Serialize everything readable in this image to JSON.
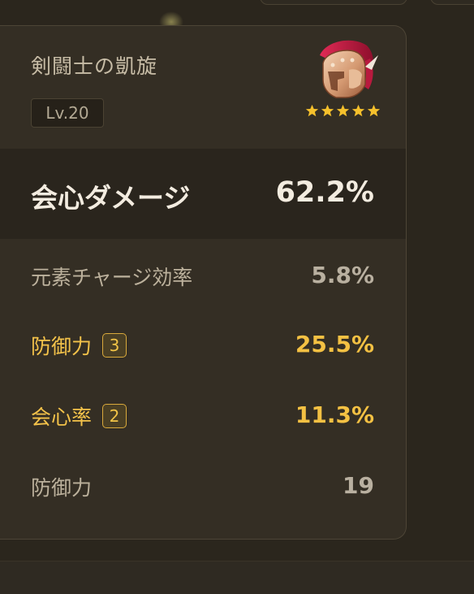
{
  "artifact": {
    "set_name": "剣闘士の凱旋",
    "level": "Lv.20",
    "rarity_stars": 5,
    "icon": "gladiator-helmet-icon"
  },
  "main_stat": {
    "label": "会心ダメージ",
    "value": "62.2%"
  },
  "sub_stats": [
    {
      "label": "元素チャージ効率",
      "value": "5.8%",
      "rolls": "",
      "highlight": false
    },
    {
      "label": "防御力",
      "value": "25.5%",
      "rolls": "3",
      "highlight": true
    },
    {
      "label": "会心率",
      "value": "11.3%",
      "rolls": "2",
      "highlight": true
    },
    {
      "label": "防御力",
      "value": "19",
      "rolls": "",
      "highlight": false
    }
  ],
  "colors": {
    "background": "#2b261d",
    "card": "#342e24",
    "highlight_gold": "#f4c143",
    "star_gold": "#f5c02c"
  }
}
